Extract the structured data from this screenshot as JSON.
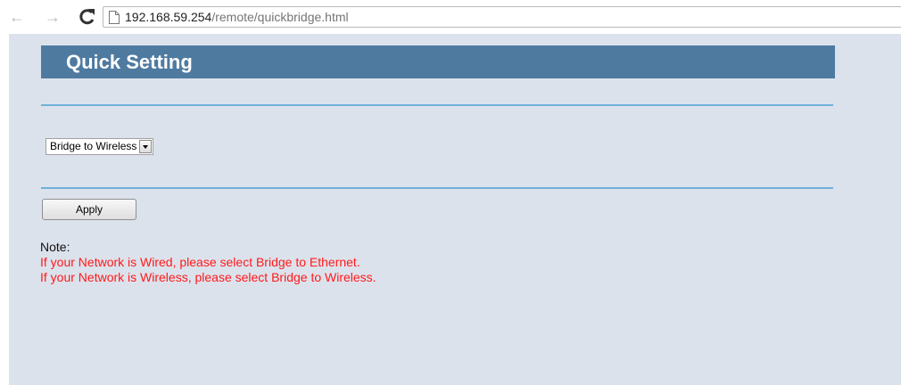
{
  "browser": {
    "url_host": "192.168.59.254",
    "url_path": "/remote/quickbridge.html"
  },
  "page": {
    "title": "Quick Setting",
    "mode_select": {
      "selected": "Bridge to Wireless"
    },
    "apply_label": "Apply",
    "note": {
      "label": "Note:",
      "lines": [
        "If your Network is Wired, please select Bridge to Ethernet.",
        "If your Network is Wireless, please select Bridge to Wireless."
      ]
    }
  },
  "colors": {
    "title_bar": "#4f7aa0",
    "page_background": "#dce2ec",
    "divider": "#6fb0d8",
    "note_text": "#ff1a1a"
  }
}
